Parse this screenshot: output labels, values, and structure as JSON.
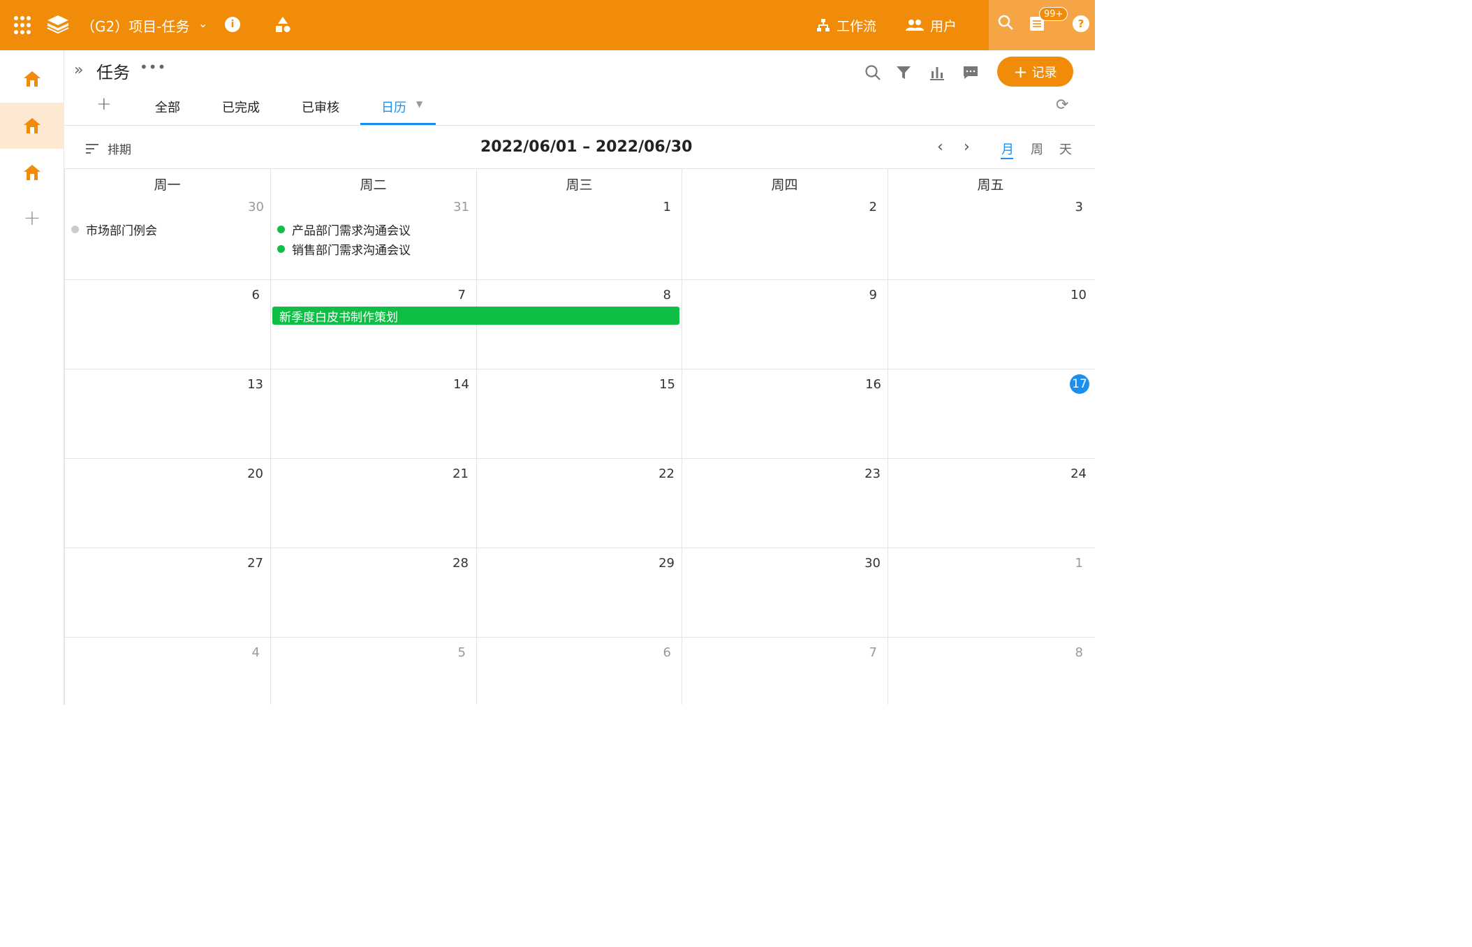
{
  "app": {
    "title": "（G2）项目-任务",
    "workflow_label": "工作流",
    "users_label": "用户",
    "badge": "99+",
    "brand_color": "#f08c0a",
    "accent_color": "#1a8ff0",
    "event_green": "#0fbf45"
  },
  "page": {
    "title": "任务",
    "add_record_label": "记录"
  },
  "tabs": [
    {
      "label": "全部"
    },
    {
      "label": "已完成"
    },
    {
      "label": "已审核"
    },
    {
      "label": "日历",
      "active": true
    }
  ],
  "calendar": {
    "schedule_label": "排期",
    "range": "2022/06/01 – 2022/06/30",
    "views": [
      "月",
      "周",
      "天"
    ],
    "active_view": "月",
    "weekdays": [
      "周一",
      "周二",
      "周三",
      "周四",
      "周五"
    ],
    "weeks": [
      [
        "30",
        "31",
        "1",
        "2",
        "3"
      ],
      [
        "6",
        "7",
        "8",
        "9",
        "10"
      ],
      [
        "13",
        "14",
        "15",
        "16",
        "17"
      ],
      [
        "20",
        "21",
        "22",
        "23",
        "24"
      ],
      [
        "27",
        "28",
        "29",
        "30",
        "1"
      ],
      [
        "4",
        "5",
        "6",
        "7",
        "8"
      ]
    ],
    "today": "17",
    "events": [
      {
        "title": "市场部门例会",
        "status_color": "#cccccc"
      },
      {
        "title": "产品部门需求沟通会议",
        "status_color": "#0fbf45"
      },
      {
        "title": "销售部门需求沟通会议",
        "status_color": "#0fbf45"
      }
    ],
    "span_event": {
      "title": "新季度白皮书制作策划"
    }
  }
}
